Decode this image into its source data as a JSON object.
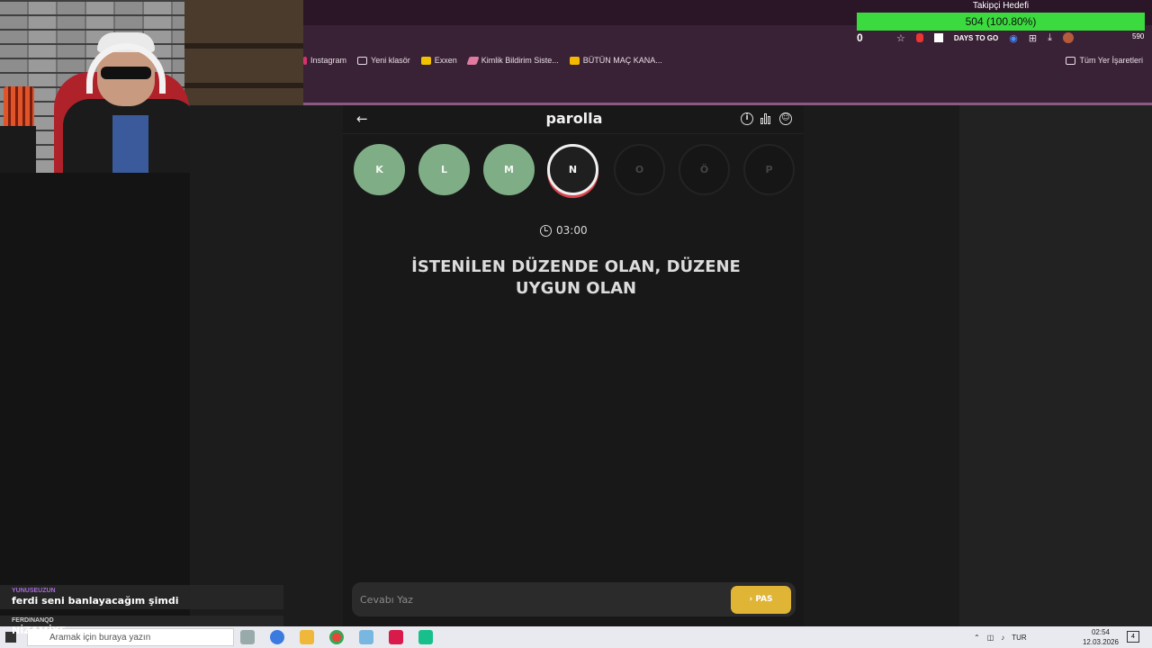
{
  "overlay": {
    "goal_title": "Takipçi Hedefi",
    "goal_value": "504 (100.80%)",
    "goal_progress": 1.0,
    "counter": "0",
    "extension_label": "DAYS TO GO",
    "streak_number": "590"
  },
  "bookmarks": [
    {
      "label": "Instagram",
      "icon": "instagram-icon",
      "color": "#d6336c"
    },
    {
      "label": "Yeni klasör",
      "icon": "folder-icon",
      "color": "#e8dce6"
    },
    {
      "label": "Exxen",
      "icon": "exxen-icon",
      "color": "#f2c200"
    },
    {
      "label": "Kimlik Bildirim Siste...",
      "icon": "link-icon",
      "color": "#e07aa0"
    },
    {
      "label": "BÜTÜN MAÇ KANA...",
      "icon": "jp-icon",
      "color": "#f5b800"
    }
  ],
  "all_bookmarks": "Tüm Yer İşaretleri",
  "game": {
    "logo": "parolla",
    "letters": [
      {
        "char": "K",
        "state": "done"
      },
      {
        "char": "L",
        "state": "done"
      },
      {
        "char": "M",
        "state": "done"
      },
      {
        "char": "N",
        "state": "active"
      },
      {
        "char": "O",
        "state": "pending"
      },
      {
        "char": "Ö",
        "state": "pending"
      },
      {
        "char": "P",
        "state": "pending"
      }
    ],
    "timer": "03:00",
    "question_line1": "İSTENİLEN DÜZENDE OLAN, DÜZENE",
    "question_line2": "UYGUN OLAN",
    "answer_placeholder": "Cevabı Yaz",
    "pass_label": "PAS",
    "colors": {
      "done": "#7fae86",
      "pass": "#e0b535",
      "active_ring": "#d9464e"
    }
  },
  "chat": [
    {
      "user": "YUNUSEUZUN",
      "user_color": "#a86bd8",
      "text": "ferdi seni banlayacağım şimdi"
    },
    {
      "user": "FERDINANQD",
      "user_color": "#cfcfcf",
      "text": "NİZAMİYE"
    }
  ],
  "taskbar": {
    "search_placeholder": "Aramak için buraya yazın",
    "language": "TUR",
    "time": "02:54",
    "date": "12.03.2026",
    "notification_count": "4"
  }
}
